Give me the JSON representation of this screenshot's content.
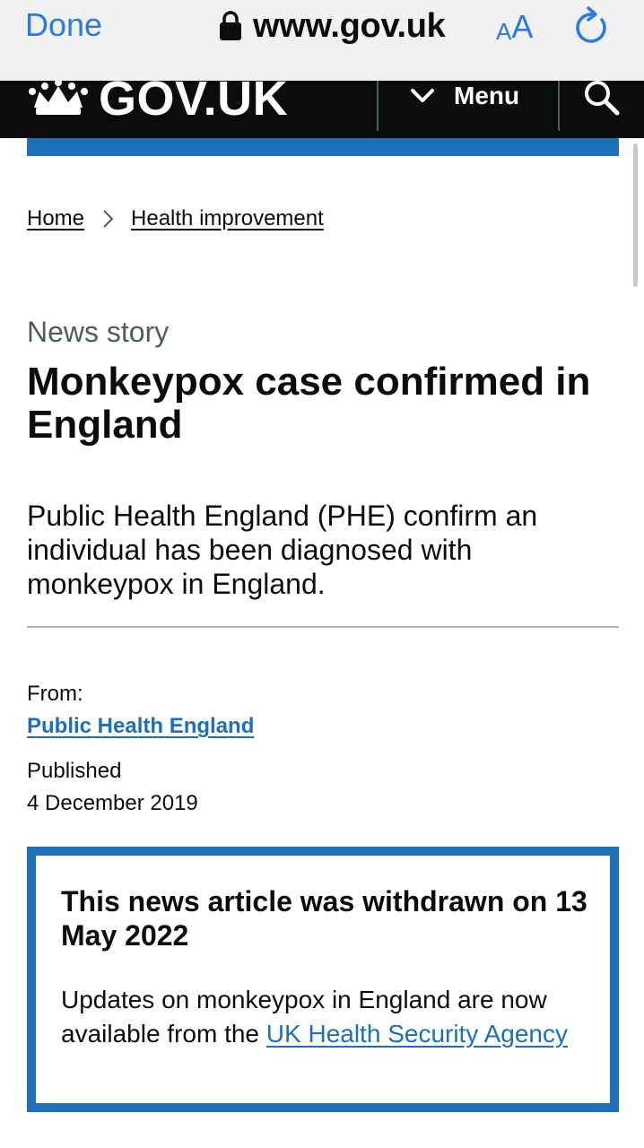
{
  "browser": {
    "done_label": "Done",
    "url": "www.gov.uk",
    "text_size_small": "A",
    "text_size_large": "A",
    "icons": [
      "lock-icon",
      "reload-icon"
    ]
  },
  "header": {
    "logo_text": "GOV.UK",
    "menu_label": "Menu",
    "icons": [
      "crown-icon",
      "chevron-down-icon",
      "search-icon"
    ]
  },
  "breadcrumb": [
    {
      "label": "Home"
    },
    {
      "label": "Health improvement"
    }
  ],
  "article": {
    "caption": "News story",
    "title": "Monkeypox case confirmed in England",
    "lede": "Public Health England (PHE) confirm an individual has been diagnosed with monkeypox in England."
  },
  "metadata": {
    "from_label": "From:",
    "organisation": "Public Health England",
    "published_label": "Published",
    "published_date": "4 December 2019"
  },
  "withdrawn": {
    "title": "This news article was withdrawn on 13 May 2022",
    "body_text": "Updates on monkeypox in England are now available from the ",
    "link_text": "UK Health Security Agency"
  },
  "colors": {
    "brand_blue": "#1d70b8",
    "header_black": "#0b0c0c",
    "safari_accent": "#2a7ae2"
  }
}
